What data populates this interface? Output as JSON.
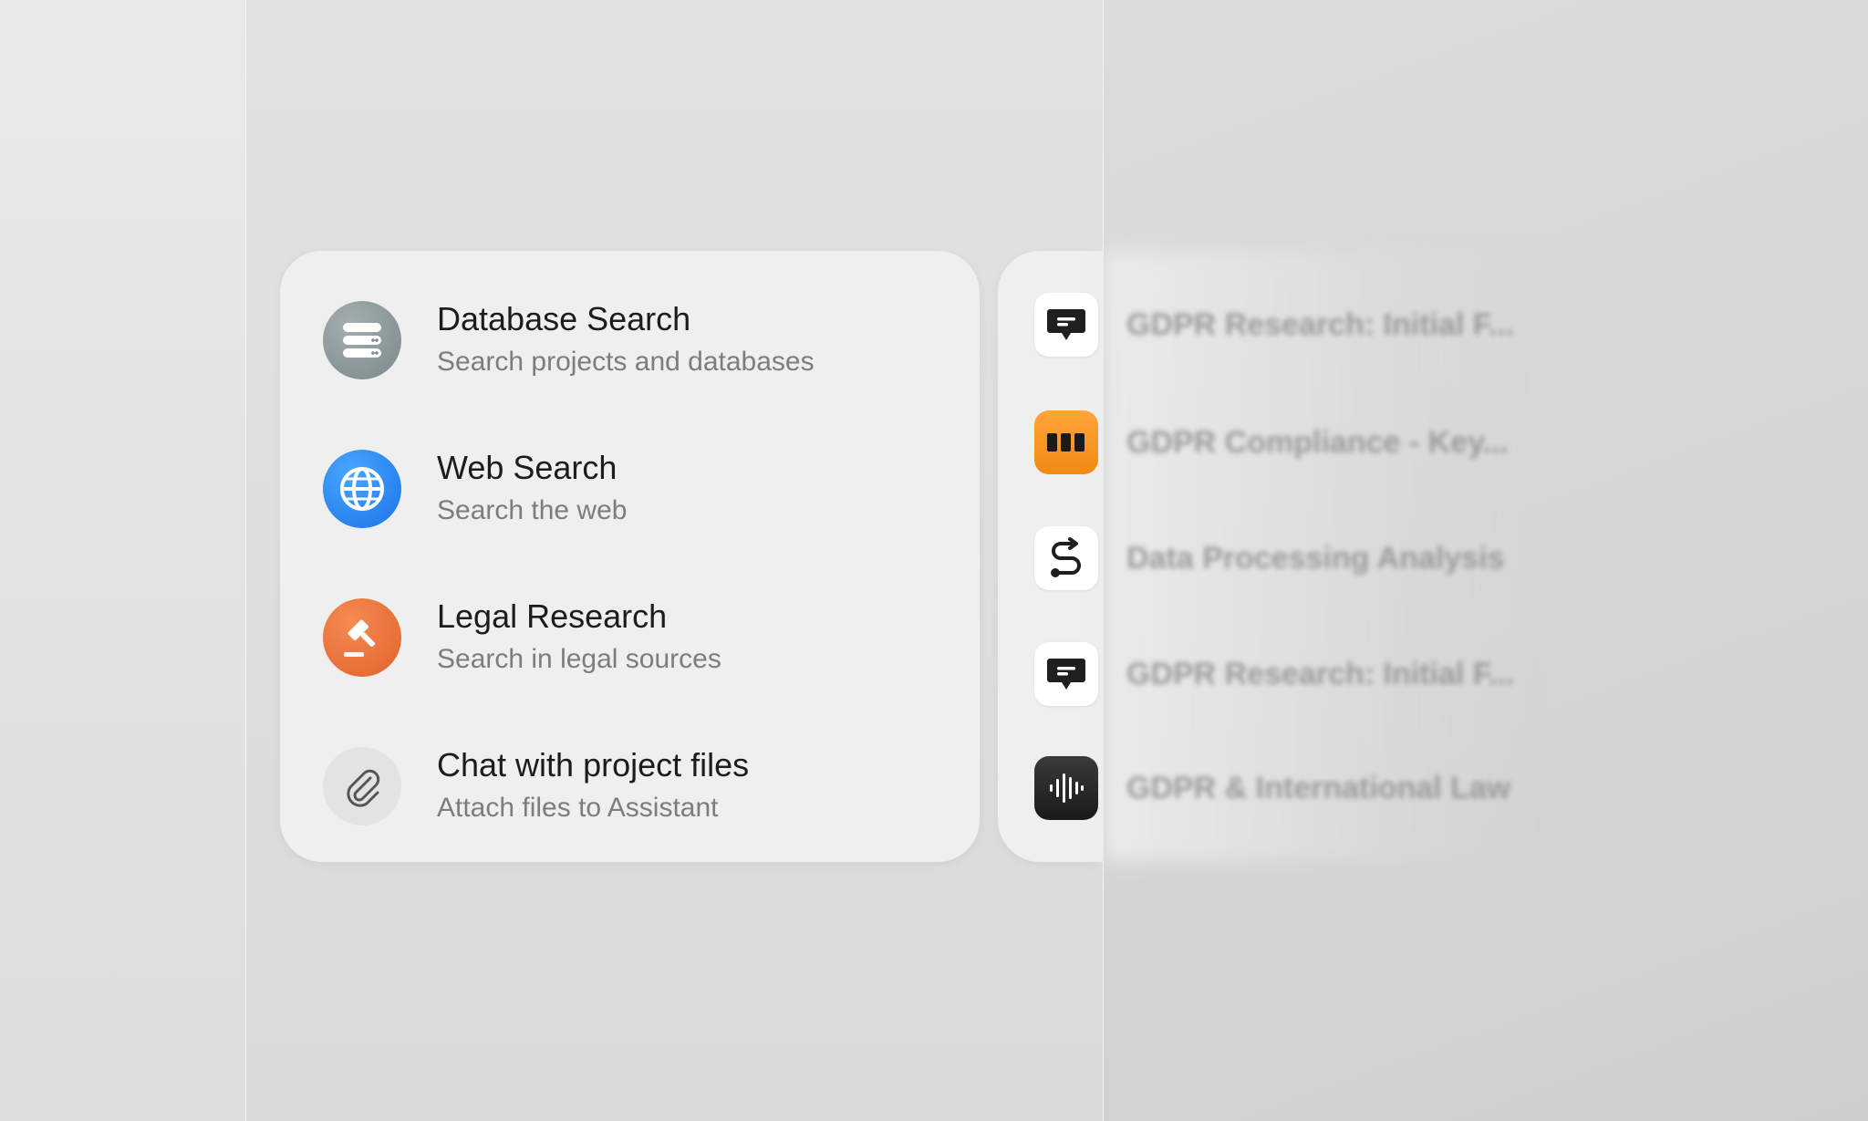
{
  "menu": {
    "items": [
      {
        "title": "Database Search",
        "subtitle": "Search projects and databases",
        "icon": "database-icon"
      },
      {
        "title": "Web Search",
        "subtitle": "Search the web",
        "icon": "globe-icon"
      },
      {
        "title": "Legal Research",
        "subtitle": "Search in legal sources",
        "icon": "gavel-icon"
      },
      {
        "title": "Chat with project files",
        "subtitle": "Attach files to Assistant",
        "icon": "paperclip-icon"
      }
    ]
  },
  "recent": {
    "items": [
      {
        "label": "GDPR Research: Initial F...",
        "icon": "chat-bubble-icon"
      },
      {
        "label": "GDPR Compliance - Key...",
        "icon": "bars-icon"
      },
      {
        "label": "Data Processing Analysis",
        "icon": "route-icon"
      },
      {
        "label": "GDPR Research: Initial F...",
        "icon": "chat-bubble-icon"
      },
      {
        "label": "GDPR & International Law",
        "icon": "waveform-icon"
      }
    ]
  },
  "colors": {
    "web_accent": "#1a73e8",
    "legal_accent": "#e0642c",
    "db_accent": "#7c8889",
    "orange_icon": "#f08a12"
  }
}
